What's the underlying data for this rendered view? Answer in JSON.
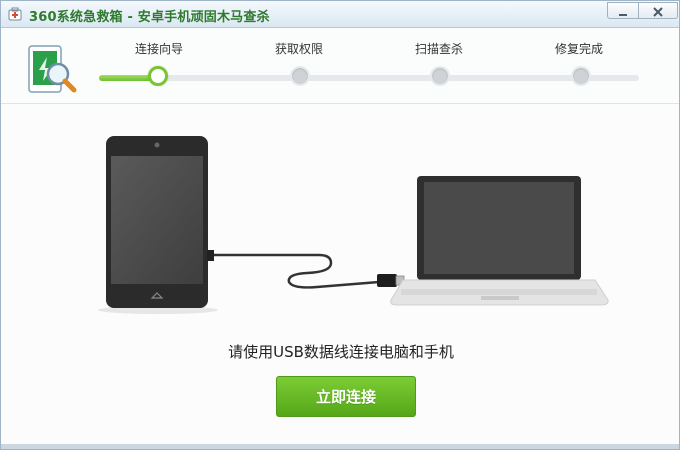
{
  "window": {
    "title": "360系统急救箱 - 安卓手机顽固木马查杀"
  },
  "steps": [
    {
      "label": "连接向导",
      "state": "active"
    },
    {
      "label": "获取权限",
      "state": "pending"
    },
    {
      "label": "扫描查杀",
      "state": "pending"
    },
    {
      "label": "修复完成",
      "state": "pending"
    }
  ],
  "main": {
    "instruction": "请使用USB数据线连接电脑和手机",
    "connect_button": "立即连接"
  },
  "colors": {
    "brand_green": "#6cc02c",
    "title_green": "#2f7a2f",
    "pending_dot": "#cfd3d6"
  },
  "icons": [
    "app-icon",
    "minimize-icon",
    "close-icon",
    "phone-scan-logo-icon",
    "phone-icon",
    "usb-cable-icon",
    "laptop-icon"
  ]
}
